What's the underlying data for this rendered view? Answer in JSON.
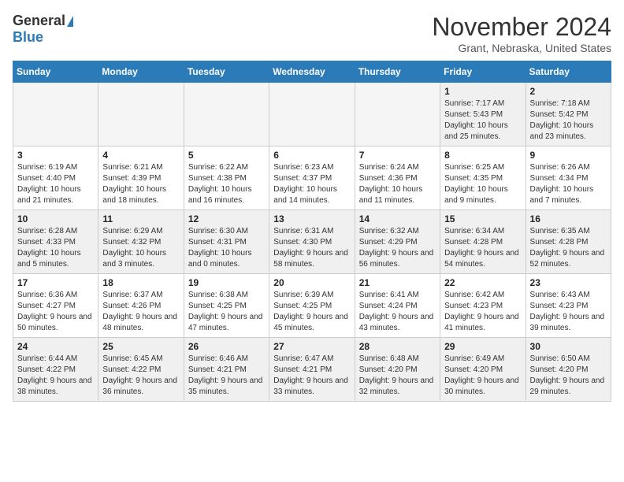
{
  "logo": {
    "general": "General",
    "blue": "Blue"
  },
  "title": "November 2024",
  "subtitle": "Grant, Nebraska, United States",
  "days_header": [
    "Sunday",
    "Monday",
    "Tuesday",
    "Wednesday",
    "Thursday",
    "Friday",
    "Saturday"
  ],
  "weeks": [
    [
      {
        "day": "",
        "sunrise": "",
        "sunset": "",
        "daylight": "",
        "empty": true
      },
      {
        "day": "",
        "sunrise": "",
        "sunset": "",
        "daylight": "",
        "empty": true
      },
      {
        "day": "",
        "sunrise": "",
        "sunset": "",
        "daylight": "",
        "empty": true
      },
      {
        "day": "",
        "sunrise": "",
        "sunset": "",
        "daylight": "",
        "empty": true
      },
      {
        "day": "",
        "sunrise": "",
        "sunset": "",
        "daylight": "",
        "empty": true
      },
      {
        "day": "1",
        "sunrise": "Sunrise: 7:17 AM",
        "sunset": "Sunset: 5:43 PM",
        "daylight": "Daylight: 10 hours and 25 minutes.",
        "empty": false
      },
      {
        "day": "2",
        "sunrise": "Sunrise: 7:18 AM",
        "sunset": "Sunset: 5:42 PM",
        "daylight": "Daylight: 10 hours and 23 minutes.",
        "empty": false
      }
    ],
    [
      {
        "day": "3",
        "sunrise": "Sunrise: 6:19 AM",
        "sunset": "Sunset: 4:40 PM",
        "daylight": "Daylight: 10 hours and 21 minutes.",
        "empty": false
      },
      {
        "day": "4",
        "sunrise": "Sunrise: 6:21 AM",
        "sunset": "Sunset: 4:39 PM",
        "daylight": "Daylight: 10 hours and 18 minutes.",
        "empty": false
      },
      {
        "day": "5",
        "sunrise": "Sunrise: 6:22 AM",
        "sunset": "Sunset: 4:38 PM",
        "daylight": "Daylight: 10 hours and 16 minutes.",
        "empty": false
      },
      {
        "day": "6",
        "sunrise": "Sunrise: 6:23 AM",
        "sunset": "Sunset: 4:37 PM",
        "daylight": "Daylight: 10 hours and 14 minutes.",
        "empty": false
      },
      {
        "day": "7",
        "sunrise": "Sunrise: 6:24 AM",
        "sunset": "Sunset: 4:36 PM",
        "daylight": "Daylight: 10 hours and 11 minutes.",
        "empty": false
      },
      {
        "day": "8",
        "sunrise": "Sunrise: 6:25 AM",
        "sunset": "Sunset: 4:35 PM",
        "daylight": "Daylight: 10 hours and 9 minutes.",
        "empty": false
      },
      {
        "day": "9",
        "sunrise": "Sunrise: 6:26 AM",
        "sunset": "Sunset: 4:34 PM",
        "daylight": "Daylight: 10 hours and 7 minutes.",
        "empty": false
      }
    ],
    [
      {
        "day": "10",
        "sunrise": "Sunrise: 6:28 AM",
        "sunset": "Sunset: 4:33 PM",
        "daylight": "Daylight: 10 hours and 5 minutes.",
        "empty": false
      },
      {
        "day": "11",
        "sunrise": "Sunrise: 6:29 AM",
        "sunset": "Sunset: 4:32 PM",
        "daylight": "Daylight: 10 hours and 3 minutes.",
        "empty": false
      },
      {
        "day": "12",
        "sunrise": "Sunrise: 6:30 AM",
        "sunset": "Sunset: 4:31 PM",
        "daylight": "Daylight: 10 hours and 0 minutes.",
        "empty": false
      },
      {
        "day": "13",
        "sunrise": "Sunrise: 6:31 AM",
        "sunset": "Sunset: 4:30 PM",
        "daylight": "Daylight: 9 hours and 58 minutes.",
        "empty": false
      },
      {
        "day": "14",
        "sunrise": "Sunrise: 6:32 AM",
        "sunset": "Sunset: 4:29 PM",
        "daylight": "Daylight: 9 hours and 56 minutes.",
        "empty": false
      },
      {
        "day": "15",
        "sunrise": "Sunrise: 6:34 AM",
        "sunset": "Sunset: 4:28 PM",
        "daylight": "Daylight: 9 hours and 54 minutes.",
        "empty": false
      },
      {
        "day": "16",
        "sunrise": "Sunrise: 6:35 AM",
        "sunset": "Sunset: 4:28 PM",
        "daylight": "Daylight: 9 hours and 52 minutes.",
        "empty": false
      }
    ],
    [
      {
        "day": "17",
        "sunrise": "Sunrise: 6:36 AM",
        "sunset": "Sunset: 4:27 PM",
        "daylight": "Daylight: 9 hours and 50 minutes.",
        "empty": false
      },
      {
        "day": "18",
        "sunrise": "Sunrise: 6:37 AM",
        "sunset": "Sunset: 4:26 PM",
        "daylight": "Daylight: 9 hours and 48 minutes.",
        "empty": false
      },
      {
        "day": "19",
        "sunrise": "Sunrise: 6:38 AM",
        "sunset": "Sunset: 4:25 PM",
        "daylight": "Daylight: 9 hours and 47 minutes.",
        "empty": false
      },
      {
        "day": "20",
        "sunrise": "Sunrise: 6:39 AM",
        "sunset": "Sunset: 4:25 PM",
        "daylight": "Daylight: 9 hours and 45 minutes.",
        "empty": false
      },
      {
        "day": "21",
        "sunrise": "Sunrise: 6:41 AM",
        "sunset": "Sunset: 4:24 PM",
        "daylight": "Daylight: 9 hours and 43 minutes.",
        "empty": false
      },
      {
        "day": "22",
        "sunrise": "Sunrise: 6:42 AM",
        "sunset": "Sunset: 4:23 PM",
        "daylight": "Daylight: 9 hours and 41 minutes.",
        "empty": false
      },
      {
        "day": "23",
        "sunrise": "Sunrise: 6:43 AM",
        "sunset": "Sunset: 4:23 PM",
        "daylight": "Daylight: 9 hours and 39 minutes.",
        "empty": false
      }
    ],
    [
      {
        "day": "24",
        "sunrise": "Sunrise: 6:44 AM",
        "sunset": "Sunset: 4:22 PM",
        "daylight": "Daylight: 9 hours and 38 minutes.",
        "empty": false
      },
      {
        "day": "25",
        "sunrise": "Sunrise: 6:45 AM",
        "sunset": "Sunset: 4:22 PM",
        "daylight": "Daylight: 9 hours and 36 minutes.",
        "empty": false
      },
      {
        "day": "26",
        "sunrise": "Sunrise: 6:46 AM",
        "sunset": "Sunset: 4:21 PM",
        "daylight": "Daylight: 9 hours and 35 minutes.",
        "empty": false
      },
      {
        "day": "27",
        "sunrise": "Sunrise: 6:47 AM",
        "sunset": "Sunset: 4:21 PM",
        "daylight": "Daylight: 9 hours and 33 minutes.",
        "empty": false
      },
      {
        "day": "28",
        "sunrise": "Sunrise: 6:48 AM",
        "sunset": "Sunset: 4:20 PM",
        "daylight": "Daylight: 9 hours and 32 minutes.",
        "empty": false
      },
      {
        "day": "29",
        "sunrise": "Sunrise: 6:49 AM",
        "sunset": "Sunset: 4:20 PM",
        "daylight": "Daylight: 9 hours and 30 minutes.",
        "empty": false
      },
      {
        "day": "30",
        "sunrise": "Sunrise: 6:50 AM",
        "sunset": "Sunset: 4:20 PM",
        "daylight": "Daylight: 9 hours and 29 minutes.",
        "empty": false
      }
    ]
  ]
}
